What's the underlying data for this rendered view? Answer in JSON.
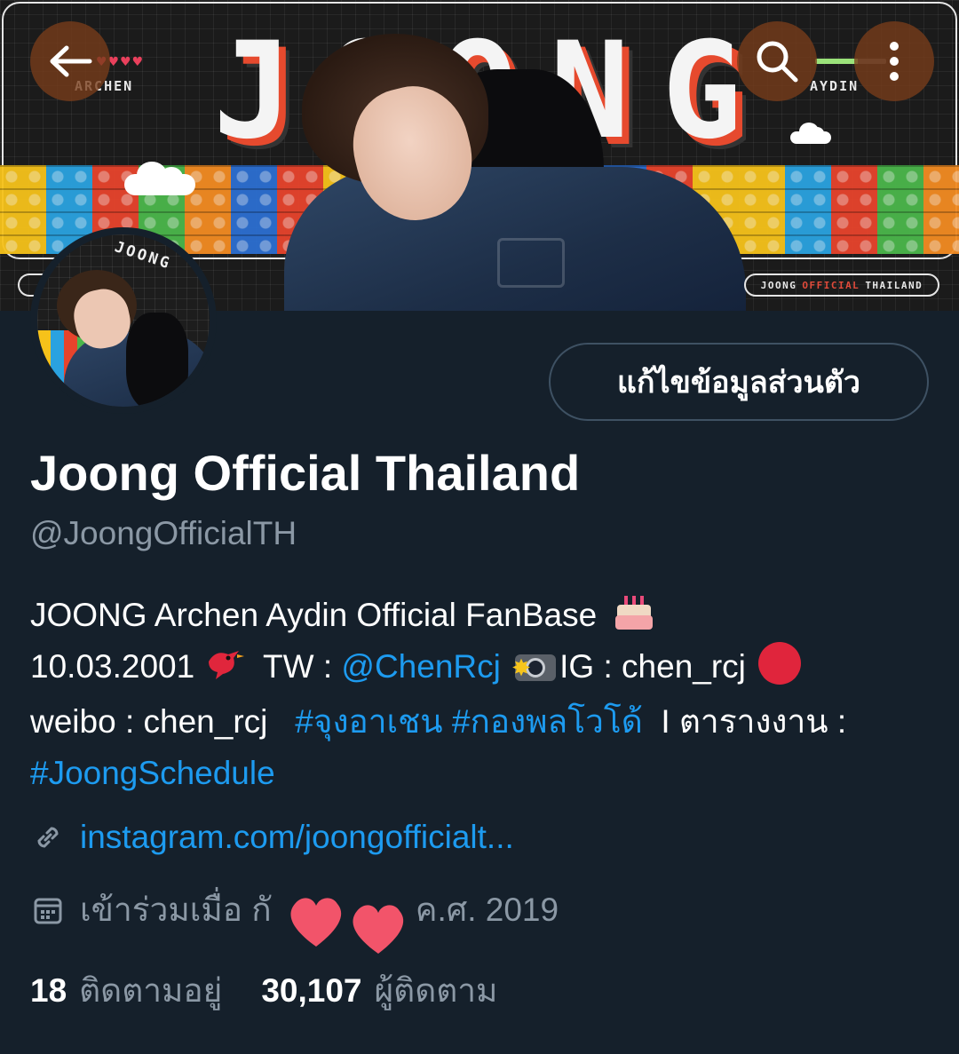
{
  "banner": {
    "title_letters": [
      "J",
      "O",
      "O",
      "N",
      "G"
    ],
    "left_label": "ARCHEN",
    "right_label": "AYDIN",
    "hearts": "♥♥♥♥",
    "official_pill": {
      "part1": "JOONG",
      "part2": "OFFICIAL",
      "part3": "THAILAND"
    },
    "avatar_label": "JOONG"
  },
  "nav": {
    "back_icon": "arrow-left-icon",
    "search_icon": "search-icon",
    "more_icon": "more-vertical-icon"
  },
  "profile": {
    "edit_button": "แก้ไขข้อมูลส่วนตัว",
    "display_name": "Joong Official Thailand",
    "handle": "@JoongOfficialTH",
    "bio": {
      "line1": "JOONG Archen Aydin Official FanBase",
      "date": "10.03.2001",
      "tw_label": "TW : ",
      "tw_link": "@ChenRcj",
      "ig": "IG : chen_rcj",
      "weibo": "weibo : chen_rcj",
      "hashtag1": "#จุงอาเชน",
      "hashtag2": "#กองพลโวโด้",
      "schedule_label": "I ตารางงาน :",
      "hashtag3": "#JoongSchedule"
    },
    "website": "instagram.com/joongofficialt...",
    "joined_prefix": "เข้าร่วมเมื่อ กั",
    "joined_suffix": "ค.ศ. 2019",
    "following_count": "18",
    "following_label": "ติดตามอยู่",
    "followers_count": "30,107",
    "followers_label": "ผู้ติดตาม"
  },
  "colors": {
    "background": "#15202b",
    "link": "#1d9bf0",
    "muted": "#8b98a5",
    "button_border": "#3e5163"
  }
}
